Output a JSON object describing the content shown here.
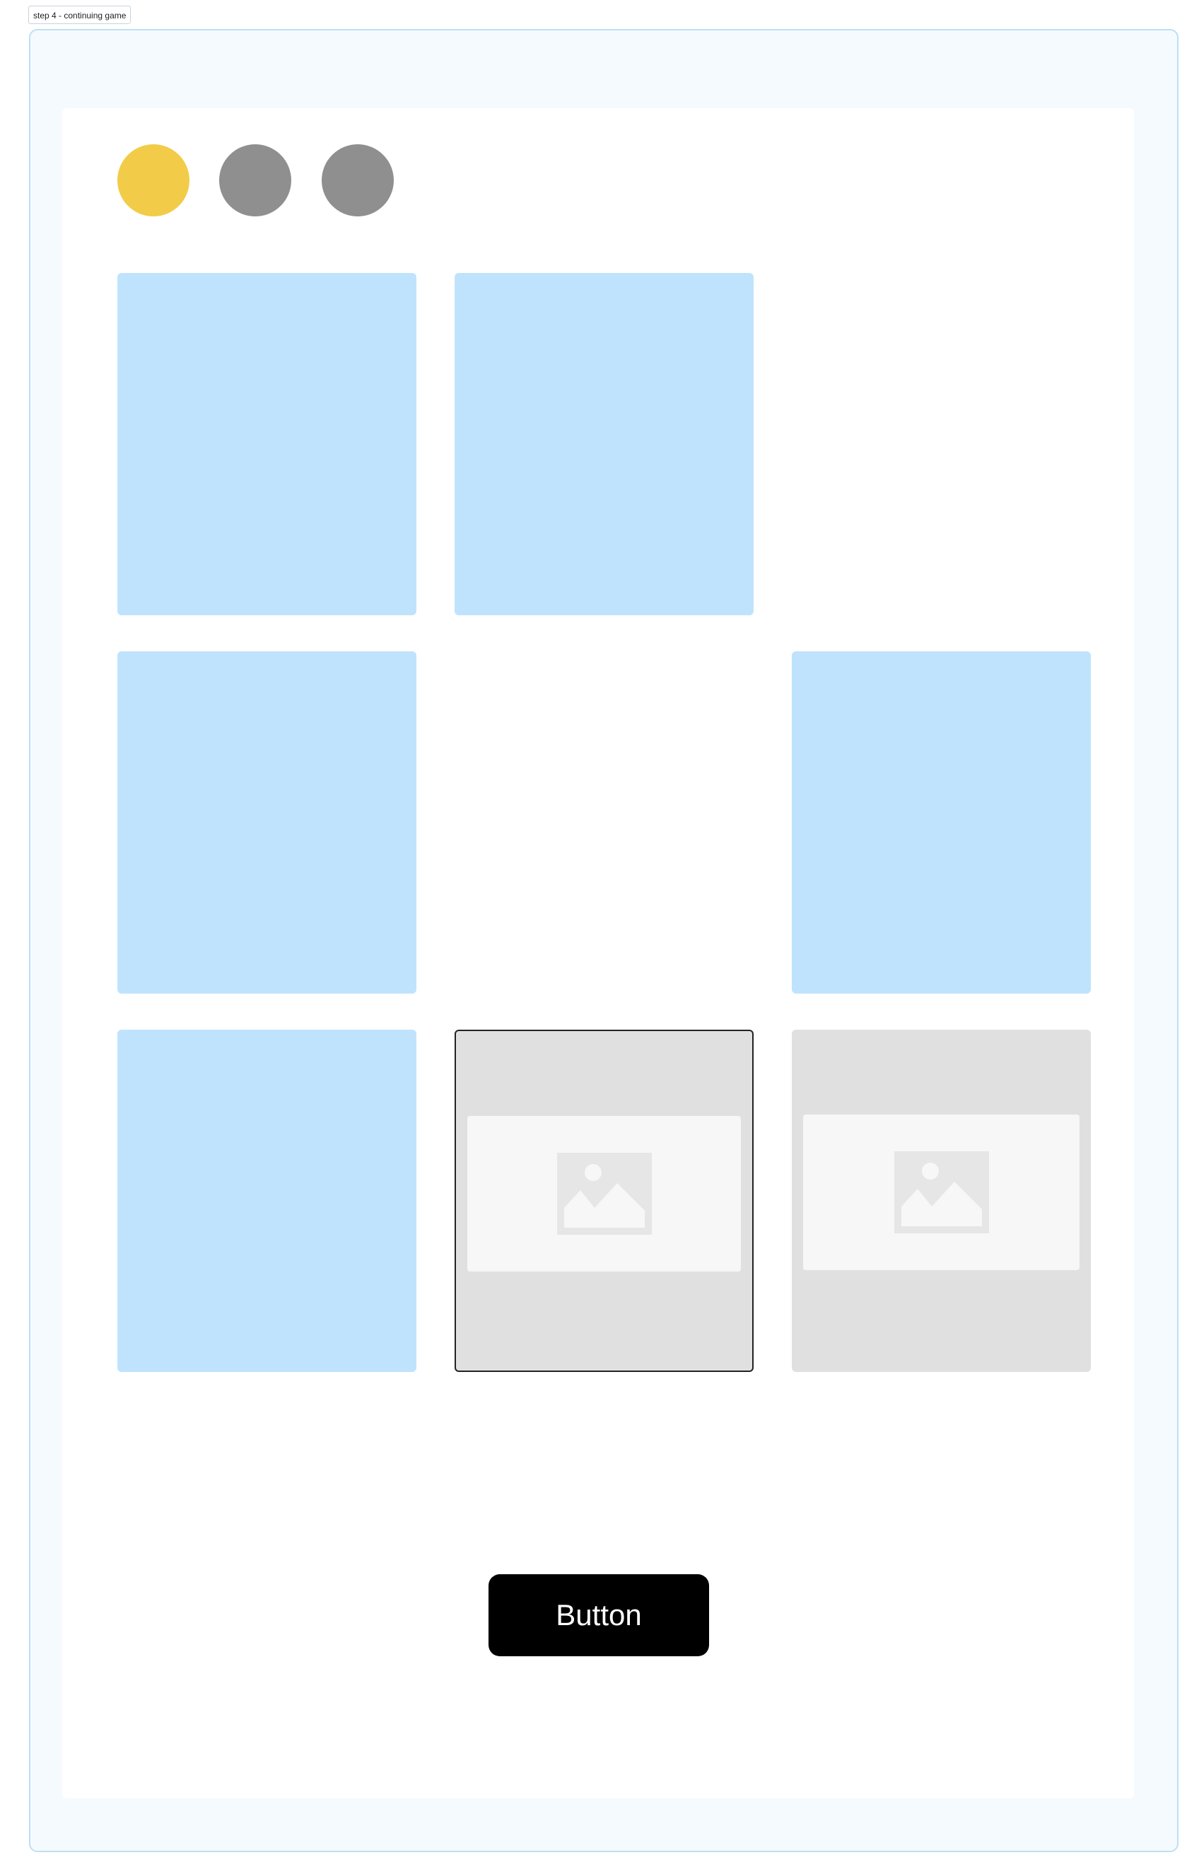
{
  "frame": {
    "label": "step 4 - continuing game"
  },
  "game": {
    "progress_dots": [
      {
        "state": "active",
        "color": "#f2cc48"
      },
      {
        "state": "inactive",
        "color": "#8f8f8f"
      },
      {
        "state": "inactive",
        "color": "#8f8f8f"
      }
    ],
    "cards": [
      {
        "state": "face-down"
      },
      {
        "state": "face-down"
      },
      {
        "state": "matched"
      },
      {
        "state": "face-down"
      },
      {
        "state": "matched"
      },
      {
        "state": "face-down"
      },
      {
        "state": "face-down"
      },
      {
        "state": "face-up",
        "selected": true,
        "icon": "image-placeholder-icon"
      },
      {
        "state": "face-up",
        "selected": false,
        "icon": "image-placeholder-icon"
      }
    ],
    "button_label": "Button"
  },
  "colors": {
    "card_back": "#bfe3fc",
    "card_face": "#e0e0e0",
    "active_dot": "#f2cc48",
    "inactive_dot": "#8f8f8f",
    "button": "#000000",
    "frame_border": "#bde0f3"
  }
}
